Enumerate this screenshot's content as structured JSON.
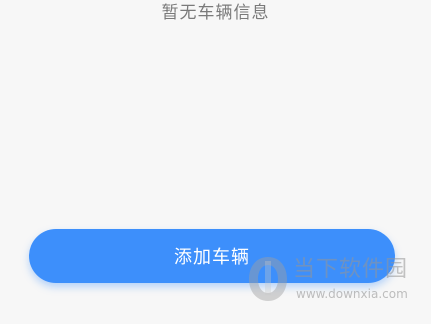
{
  "empty_state": {
    "message": "暂无车辆信息"
  },
  "actions": {
    "add_vehicle_label": "添加车辆"
  },
  "watermark": {
    "title": "当下软件园",
    "url": "www.downxia.com",
    "icon": "downxia-logo-icon"
  },
  "colors": {
    "background": "#f7f7f7",
    "accent": "#3d8ffb",
    "message_text": "#7a7a7a"
  }
}
